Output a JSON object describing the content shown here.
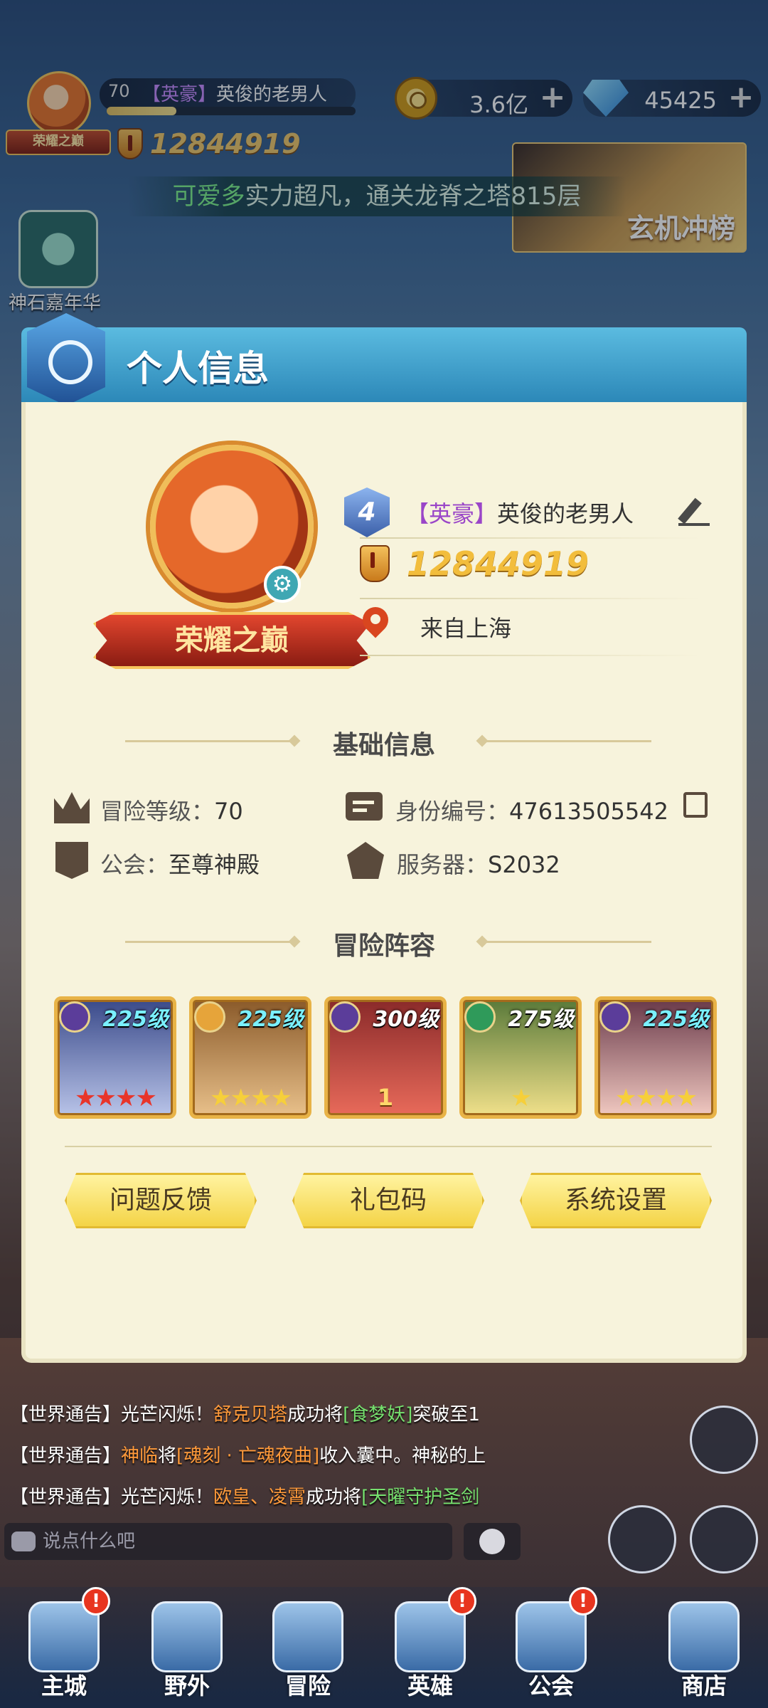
{
  "player": {
    "level": "70",
    "title_tag": "【英豪】",
    "name": "英俊的老男人",
    "rank_badge": "荣耀之巅",
    "power": "12844919",
    "xp_progress": 0.28
  },
  "currency": {
    "gold": "3.6亿",
    "gems": "45425",
    "plus": "+"
  },
  "announcement": {
    "highlight": "可爱多",
    "text": "实力超凡，通关龙脊之塔815层"
  },
  "event_banner": {
    "label": "玄机冲榜"
  },
  "side_top": {
    "label": "神石嘉年华"
  },
  "modal": {
    "title": "个人信息",
    "profile": {
      "vip_level": "4",
      "title_tag": "【英豪】",
      "name": "英俊的老男人",
      "power": "12844919",
      "location": "来自上海",
      "rank_ribbon": "荣耀之巅"
    },
    "basic_info": {
      "section_title": "基础信息",
      "adventure_level_label": "冒险等级：",
      "adventure_level": "70",
      "id_label": "身份编号：",
      "id_value": "47613505542",
      "guild_label": "公会：",
      "guild_value": "至尊神殿",
      "server_label": "服务器：",
      "server_value": "S2032"
    },
    "team": {
      "section_title": "冒险阵容",
      "heroes": [
        {
          "level": "225级",
          "level_color": "#7af0ff",
          "faction_color": "#5b3d9a",
          "art": [
            "#3a4a8a",
            "#b8c3e8"
          ],
          "stars": "★★★★",
          "star_color": "#e8352a",
          "rank": ""
        },
        {
          "level": "225级",
          "level_color": "#7af0ff",
          "faction_color": "#e6a43a",
          "art": [
            "#8a5a2a",
            "#e8c08a"
          ],
          "stars": "★★★★",
          "star_color": "#f6cf3a",
          "rank": ""
        },
        {
          "level": "300级",
          "level_color": "#ffffff",
          "faction_color": "#5b3d9a",
          "art": [
            "#8a2a2a",
            "#e86a5a"
          ],
          "stars": "",
          "star_color": "#f6cf3a",
          "rank": "1"
        },
        {
          "level": "275级",
          "level_color": "#ffffff",
          "faction_color": "#2f9a5a",
          "art": [
            "#5a7a3a",
            "#f0e08a"
          ],
          "stars": "★",
          "star_color": "#f6cf3a",
          "rank": ""
        },
        {
          "level": "225级",
          "level_color": "#7af0ff",
          "faction_color": "#5b3d9a",
          "art": [
            "#6a3a4a",
            "#f0c8c0"
          ],
          "stars": "★★★★",
          "star_color": "#f6cf3a",
          "rank": ""
        }
      ]
    },
    "buttons": {
      "feedback": "问题反馈",
      "gift_code": "礼包码",
      "settings": "系统设置"
    }
  },
  "chat": {
    "lines": [
      {
        "prefix": "【世界通告】",
        "parts": [
          {
            "t": "光芒闪烁！",
            "c": ""
          },
          {
            "t": "舒克贝塔",
            "c": "orange"
          },
          {
            "t": "成功将",
            "c": ""
          },
          {
            "t": "[食梦妖]",
            "c": "green"
          },
          {
            "t": "突破至1",
            "c": ""
          }
        ]
      },
      {
        "prefix": "【世界通告】",
        "parts": [
          {
            "t": "神临",
            "c": "orange"
          },
          {
            "t": "将",
            "c": ""
          },
          {
            "t": "[魂刻 · 亡魂夜曲]",
            "c": "orange"
          },
          {
            "t": "收入囊中。神秘的上",
            "c": ""
          }
        ]
      },
      {
        "prefix": "【世界通告】",
        "parts": [
          {
            "t": "光芒闪烁！",
            "c": ""
          },
          {
            "t": "欧皇、凌霄",
            "c": "orange"
          },
          {
            "t": "成功将",
            "c": ""
          },
          {
            "t": "[天曜守护圣剑",
            "c": "green"
          }
        ]
      }
    ],
    "input_placeholder": "说点什么吧"
  },
  "nav": {
    "items": [
      {
        "label": "主城",
        "alert": "!"
      },
      {
        "label": "野外",
        "alert": ""
      },
      {
        "label": "冒险",
        "alert": ""
      },
      {
        "label": "英雄",
        "alert": "!"
      },
      {
        "label": "公会",
        "alert": "!"
      },
      {
        "label": "商店",
        "alert": ""
      }
    ]
  }
}
